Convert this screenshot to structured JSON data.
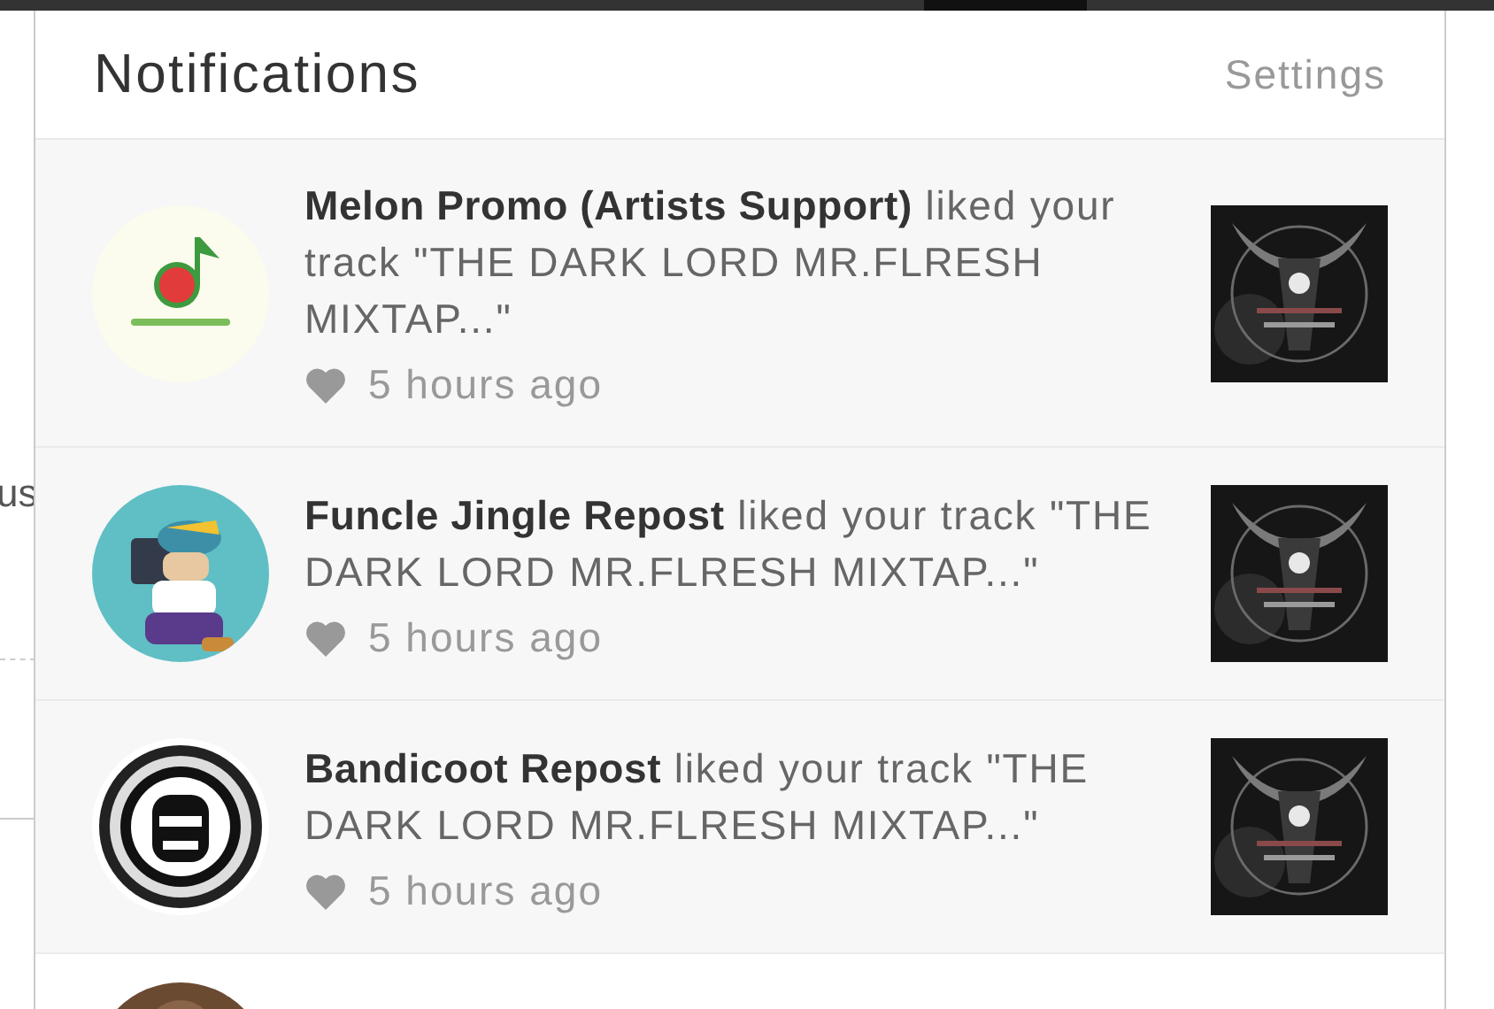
{
  "background_fragment": {
    "text": "us"
  },
  "panel": {
    "title": "Notifications",
    "settings_link": "Settings"
  },
  "notifications": [
    {
      "message": "**Melon Promo (Artists Support)** liked your track \"THE DARK LORD MR.FLRESH MIXTAP...\"",
      "time": "5 hours ago"
    },
    {
      "message": "**Funcle Jingle Repost** liked your track \"THE DARK LORD MR.FLRESH MIXTAP...\"",
      "time": "5 hours ago"
    },
    {
      "message": "**Bandicoot Repost** liked your track \"THE DARK LORD MR.FLRESH MIXTAP...\"",
      "time": "5 hours ago"
    }
  ]
}
